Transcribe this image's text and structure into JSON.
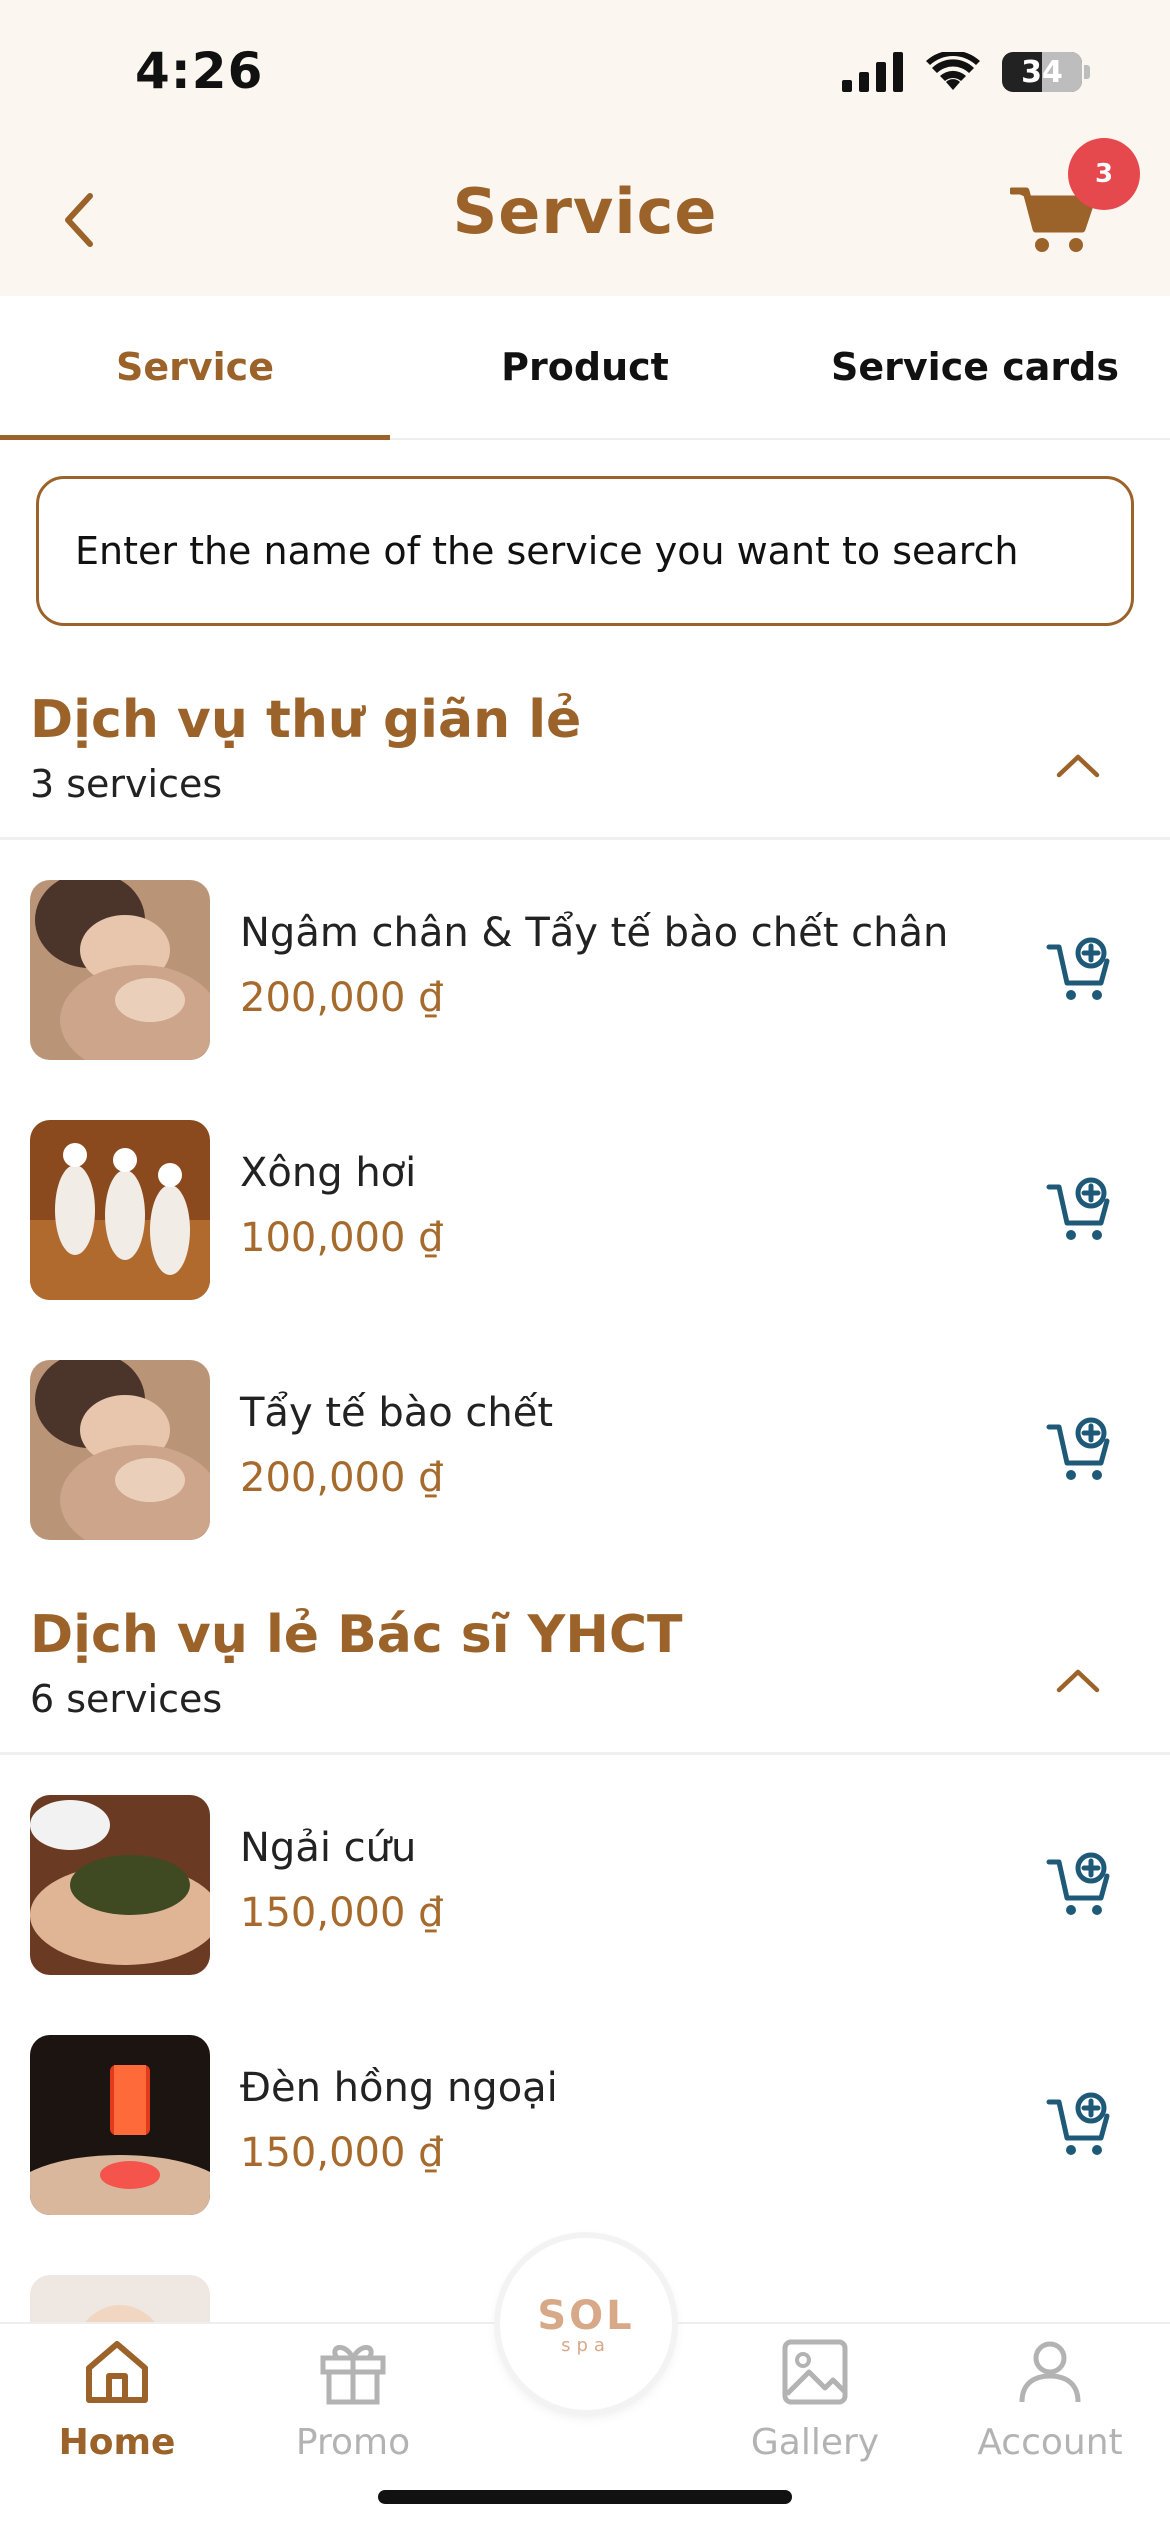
{
  "status_bar": {
    "time": "4:26",
    "battery": "34"
  },
  "header": {
    "title": "Service",
    "cart_count": "3"
  },
  "tabs": [
    {
      "label": "Service",
      "active": true
    },
    {
      "label": "Product",
      "active": false
    },
    {
      "label": "Service cards",
      "active": false
    }
  ],
  "search": {
    "placeholder": "Enter the name of the service you want to search"
  },
  "sections": [
    {
      "title": "Dịch vụ thư giãn lẻ",
      "count": "3 services",
      "items": [
        {
          "name": "Ngâm chân & Tẩy tế bào chết chân",
          "price": "200,000 ₫"
        },
        {
          "name": "Xông hơi",
          "price": "100,000 ₫"
        },
        {
          "name": "Tẩy tế bào chết",
          "price": "200,000 ₫"
        }
      ]
    },
    {
      "title": "Dịch vụ lẻ Bác sĩ YHCT",
      "count": "6 services",
      "items": [
        {
          "name": "Ngải cứu",
          "price": "150,000 ₫"
        },
        {
          "name": "Đèn hồng ngoại",
          "price": "150,000 ₫"
        }
      ]
    }
  ],
  "logo": {
    "text": "SOL",
    "sub": "spa"
  },
  "tabbar": [
    {
      "label": "Home",
      "icon": "home-icon",
      "active": true
    },
    {
      "label": "Promo",
      "icon": "gift-icon",
      "active": false
    },
    {
      "label": "Gallery",
      "icon": "image-icon",
      "active": false
    },
    {
      "label": "Account",
      "icon": "user-icon",
      "active": false
    }
  ],
  "colors": {
    "accent": "#9b6229",
    "price": "#a66a2c",
    "cart_icon": "#1e5a78",
    "badge": "#e5484d",
    "header_bg": "#fcf6f1"
  }
}
